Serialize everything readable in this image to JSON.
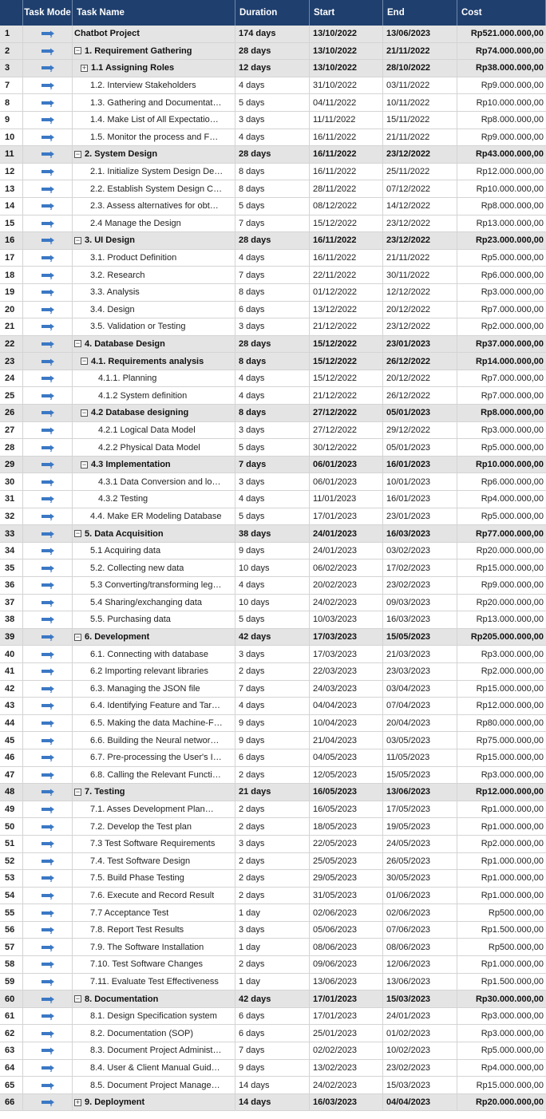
{
  "header": {
    "id": "",
    "task_mode": "Task Mode",
    "task_name": "Task Name",
    "duration": "Duration",
    "start": "Start",
    "end": "End",
    "cost": "Cost"
  },
  "icons": {
    "task_mode": "auto-scheduled-task-icon",
    "expand": "expand-plus-icon",
    "collapse": "collapse-minus-icon"
  },
  "colors": {
    "header_bg": "#1f3f6e",
    "summary_bg": "#e4e4e4",
    "mode_icon": "#3b78c4"
  },
  "rows": [
    {
      "id": "1",
      "name": "Chatbot Project",
      "duration": "174 days",
      "start": "13/10/2022",
      "end": "13/06/2023",
      "cost": "Rp521.000.000,00",
      "level": 0,
      "summary": true
    },
    {
      "id": "2",
      "name": "1. Requirement Gathering",
      "duration": "28 days",
      "start": "13/10/2022",
      "end": "21/11/2022",
      "cost": "Rp74.000.000,00",
      "level": 0,
      "summary": true,
      "toggle": "minus"
    },
    {
      "id": "3",
      "name": "1.1 Assigning Roles",
      "duration": "12 days",
      "start": "13/10/2022",
      "end": "28/10/2022",
      "cost": "Rp38.000.000,00",
      "level": 1,
      "summary": true,
      "toggle": "plus"
    },
    {
      "id": "7",
      "name": "1.2. Interview Stakeholders",
      "duration": "4 days",
      "start": "31/10/2022",
      "end": "03/11/2022",
      "cost": "Rp9.000.000,00",
      "level": 2
    },
    {
      "id": "8",
      "name": "1.3. Gathering and Documentat…",
      "duration": "5 days",
      "start": "04/11/2022",
      "end": "10/11/2022",
      "cost": "Rp10.000.000,00",
      "level": 2
    },
    {
      "id": "9",
      "name": "1.4. Make List of All Expectatio…",
      "duration": "3 days",
      "start": "11/11/2022",
      "end": "15/11/2022",
      "cost": "Rp8.000.000,00",
      "level": 2
    },
    {
      "id": "10",
      "name": "1.5. Monitor the process and  F…",
      "duration": "4 days",
      "start": "16/11/2022",
      "end": "21/11/2022",
      "cost": "Rp9.000.000,00",
      "level": 2
    },
    {
      "id": "11",
      "name": "2. System Design",
      "duration": "28 days",
      "start": "16/11/2022",
      "end": "23/12/2022",
      "cost": "Rp43.000.000,00",
      "level": 0,
      "summary": true,
      "toggle": "minus"
    },
    {
      "id": "12",
      "name": "2.1. Initialize System Design De…",
      "duration": "8 days",
      "start": "16/11/2022",
      "end": "25/11/2022",
      "cost": "Rp12.000.000,00",
      "level": 2
    },
    {
      "id": "13",
      "name": "2.2. Establish System Design C…",
      "duration": "8 days",
      "start": "28/11/2022",
      "end": "07/12/2022",
      "cost": "Rp10.000.000,00",
      "level": 2
    },
    {
      "id": "14",
      "name": "2.3. Assess alternatives for  obt…",
      "duration": "5 days",
      "start": "08/12/2022",
      "end": "14/12/2022",
      "cost": "Rp8.000.000,00",
      "level": 2
    },
    {
      "id": "15",
      "name": "2.4 Manage the Design",
      "duration": "7 days",
      "start": "15/12/2022",
      "end": "23/12/2022",
      "cost": "Rp13.000.000,00",
      "level": 2
    },
    {
      "id": "16",
      "name": "3. UI Design",
      "duration": "28 days",
      "start": "16/11/2022",
      "end": "23/12/2022",
      "cost": "Rp23.000.000,00",
      "level": 0,
      "summary": true,
      "toggle": "minus"
    },
    {
      "id": "17",
      "name": "3.1. Product Definition",
      "duration": "4 days",
      "start": "16/11/2022",
      "end": "21/11/2022",
      "cost": "Rp5.000.000,00",
      "level": 2
    },
    {
      "id": "18",
      "name": "3.2. Research",
      "duration": "7 days",
      "start": "22/11/2022",
      "end": "30/11/2022",
      "cost": "Rp6.000.000,00",
      "level": 2
    },
    {
      "id": "19",
      "name": "3.3. Analysis",
      "duration": "8 days",
      "start": "01/12/2022",
      "end": "12/12/2022",
      "cost": "Rp3.000.000,00",
      "level": 2
    },
    {
      "id": "20",
      "name": "3.4. Design",
      "duration": "6 days",
      "start": "13/12/2022",
      "end": "20/12/2022",
      "cost": "Rp7.000.000,00",
      "level": 2
    },
    {
      "id": "21",
      "name": "3.5. Validation or Testing",
      "duration": "3 days",
      "start": "21/12/2022",
      "end": "23/12/2022",
      "cost": "Rp2.000.000,00",
      "level": 2
    },
    {
      "id": "22",
      "name": "4. Database Design",
      "duration": "28 days",
      "start": "15/12/2022",
      "end": "23/01/2023",
      "cost": "Rp37.000.000,00",
      "level": 0,
      "summary": true,
      "toggle": "minus"
    },
    {
      "id": "23",
      "name": "4.1. Requirements analysis",
      "duration": "8 days",
      "start": "15/12/2022",
      "end": "26/12/2022",
      "cost": "Rp14.000.000,00",
      "level": 1,
      "summary": true,
      "toggle": "minus"
    },
    {
      "id": "24",
      "name": "4.1.1. Planning",
      "duration": "4 days",
      "start": "15/12/2022",
      "end": "20/12/2022",
      "cost": "Rp7.000.000,00",
      "level": 3
    },
    {
      "id": "25",
      "name": "4.1.2 System definition",
      "duration": "4 days",
      "start": "21/12/2022",
      "end": "26/12/2022",
      "cost": "Rp7.000.000,00",
      "level": 3
    },
    {
      "id": "26",
      "name": "4.2 Database designing",
      "duration": "8 days",
      "start": "27/12/2022",
      "end": "05/01/2023",
      "cost": "Rp8.000.000,00",
      "level": 1,
      "summary": true,
      "toggle": "minus"
    },
    {
      "id": "27",
      "name": "4.2.1 Logical Data Model",
      "duration": "3 days",
      "start": "27/12/2022",
      "end": "29/12/2022",
      "cost": "Rp3.000.000,00",
      "level": 3
    },
    {
      "id": "28",
      "name": "4.2.2 Physical Data Model",
      "duration": "5 days",
      "start": "30/12/2022",
      "end": "05/01/2023",
      "cost": "Rp5.000.000,00",
      "level": 3
    },
    {
      "id": "29",
      "name": "4.3 Implementation",
      "duration": "7 days",
      "start": "06/01/2023",
      "end": "16/01/2023",
      "cost": "Rp10.000.000,00",
      "level": 1,
      "summary": true,
      "toggle": "minus"
    },
    {
      "id": "30",
      "name": "4.3.1 Data Conversion and lo…",
      "duration": "3 days",
      "start": "06/01/2023",
      "end": "10/01/2023",
      "cost": "Rp6.000.000,00",
      "level": 3
    },
    {
      "id": "31",
      "name": "4.3.2 Testing",
      "duration": "4 days",
      "start": "11/01/2023",
      "end": "16/01/2023",
      "cost": "Rp4.000.000,00",
      "level": 3
    },
    {
      "id": "32",
      "name": "4.4. Make ER Modeling Database",
      "duration": "5 days",
      "start": "17/01/2023",
      "end": "23/01/2023",
      "cost": "Rp5.000.000,00",
      "level": 2
    },
    {
      "id": "33",
      "name": "5. Data Acquisition",
      "duration": "38 days",
      "start": "24/01/2023",
      "end": "16/03/2023",
      "cost": "Rp77.000.000,00",
      "level": 0,
      "summary": true,
      "toggle": "minus"
    },
    {
      "id": "34",
      "name": "5.1 Acquiring data",
      "duration": "9 days",
      "start": "24/01/2023",
      "end": "03/02/2023",
      "cost": "Rp20.000.000,00",
      "level": 2
    },
    {
      "id": "35",
      "name": "5.2. Collecting new data",
      "duration": "10 days",
      "start": "06/02/2023",
      "end": "17/02/2023",
      "cost": "Rp15.000.000,00",
      "level": 2
    },
    {
      "id": "36",
      "name": "5.3 Converting/transforming leg…",
      "duration": "4 days",
      "start": "20/02/2023",
      "end": "23/02/2023",
      "cost": "Rp9.000.000,00",
      "level": 2
    },
    {
      "id": "37",
      "name": "5.4 Sharing/exchanging data",
      "duration": "10 days",
      "start": "24/02/2023",
      "end": "09/03/2023",
      "cost": "Rp20.000.000,00",
      "level": 2
    },
    {
      "id": "38",
      "name": "5.5. Purchasing data",
      "duration": "5 days",
      "start": "10/03/2023",
      "end": "16/03/2023",
      "cost": "Rp13.000.000,00",
      "level": 2
    },
    {
      "id": "39",
      "name": "6. Development",
      "duration": "42 days",
      "start": "17/03/2023",
      "end": "15/05/2023",
      "cost": "Rp205.000.000,00",
      "level": 0,
      "summary": true,
      "toggle": "minus"
    },
    {
      "id": "40",
      "name": "6.1. Connecting with database",
      "duration": "3 days",
      "start": "17/03/2023",
      "end": "21/03/2023",
      "cost": "Rp3.000.000,00",
      "level": 2
    },
    {
      "id": "41",
      "name": "6.2 Importing relevant libraries",
      "duration": "2 days",
      "start": "22/03/2023",
      "end": "23/03/2023",
      "cost": "Rp2.000.000,00",
      "level": 2
    },
    {
      "id": "42",
      "name": "6.3. Managing the JSON file",
      "duration": "7 days",
      "start": "24/03/2023",
      "end": "03/04/2023",
      "cost": "Rp15.000.000,00",
      "level": 2
    },
    {
      "id": "43",
      "name": "6.4. Identifying Feature and Tar…",
      "duration": "4 days",
      "start": "04/04/2023",
      "end": "07/04/2023",
      "cost": "Rp12.000.000,00",
      "level": 2
    },
    {
      "id": "44",
      "name": "6.5. Making the data Machine-F…",
      "duration": "9 days",
      "start": "10/04/2023",
      "end": "20/04/2023",
      "cost": "Rp80.000.000,00",
      "level": 2
    },
    {
      "id": "45",
      "name": "6.6. Building the Neural networ…",
      "duration": "9 days",
      "start": "21/04/2023",
      "end": "03/05/2023",
      "cost": "Rp75.000.000,00",
      "level": 2
    },
    {
      "id": "46",
      "name": "6.7. Pre-processing the User's I…",
      "duration": "6 days",
      "start": "04/05/2023",
      "end": "11/05/2023",
      "cost": "Rp15.000.000,00",
      "level": 2
    },
    {
      "id": "47",
      "name": "6.8. Calling the Relevant Functi…",
      "duration": "2 days",
      "start": "12/05/2023",
      "end": "15/05/2023",
      "cost": "Rp3.000.000,00",
      "level": 2
    },
    {
      "id": "48",
      "name": "7. Testing",
      "duration": "21 days",
      "start": "16/05/2023",
      "end": "13/06/2023",
      "cost": "Rp12.000.000,00",
      "level": 0,
      "summary": true,
      "toggle": "minus"
    },
    {
      "id": "49",
      "name": "7.1. Asses Development Plan…",
      "duration": "2 days",
      "start": "16/05/2023",
      "end": "17/05/2023",
      "cost": "Rp1.000.000,00",
      "level": 2
    },
    {
      "id": "50",
      "name": "7.2. Develop the Test plan",
      "duration": "2 days",
      "start": "18/05/2023",
      "end": "19/05/2023",
      "cost": "Rp1.000.000,00",
      "level": 2
    },
    {
      "id": "51",
      "name": "7.3 Test Software Requirements",
      "duration": "3 days",
      "start": "22/05/2023",
      "end": "24/05/2023",
      "cost": "Rp2.000.000,00",
      "level": 2
    },
    {
      "id": "52",
      "name": "7.4. Test Software Design",
      "duration": "2 days",
      "start": "25/05/2023",
      "end": "26/05/2023",
      "cost": "Rp1.000.000,00",
      "level": 2
    },
    {
      "id": "53",
      "name": "7.5. Build Phase Testing",
      "duration": "2 days",
      "start": "29/05/2023",
      "end": "30/05/2023",
      "cost": "Rp1.000.000,00",
      "level": 2
    },
    {
      "id": "54",
      "name": "7.6. Execute and Record Result",
      "duration": "2 days",
      "start": "31/05/2023",
      "end": "01/06/2023",
      "cost": "Rp1.000.000,00",
      "level": 2
    },
    {
      "id": "55",
      "name": "7.7 Acceptance Test",
      "duration": "1 day",
      "start": "02/06/2023",
      "end": "02/06/2023",
      "cost": "Rp500.000,00",
      "level": 2
    },
    {
      "id": "56",
      "name": "7.8. Report Test Results",
      "duration": "3 days",
      "start": "05/06/2023",
      "end": "07/06/2023",
      "cost": "Rp1.500.000,00",
      "level": 2
    },
    {
      "id": "57",
      "name": "7.9. The Software Installation",
      "duration": "1 day",
      "start": "08/06/2023",
      "end": "08/06/2023",
      "cost": "Rp500.000,00",
      "level": 2
    },
    {
      "id": "58",
      "name": "7.10. Test Software Changes",
      "duration": "2 days",
      "start": "09/06/2023",
      "end": "12/06/2023",
      "cost": "Rp1.000.000,00",
      "level": 2
    },
    {
      "id": "59",
      "name": "7.11. Evaluate Test Effectiveness",
      "duration": "1 day",
      "start": "13/06/2023",
      "end": "13/06/2023",
      "cost": "Rp1.500.000,00",
      "level": 2
    },
    {
      "id": "60",
      "name": "8. Documentation",
      "duration": "42 days",
      "start": "17/01/2023",
      "end": "15/03/2023",
      "cost": "Rp30.000.000,00",
      "level": 0,
      "summary": true,
      "toggle": "minus"
    },
    {
      "id": "61",
      "name": "8.1. Design Specification system",
      "duration": "6 days",
      "start": "17/01/2023",
      "end": "24/01/2023",
      "cost": "Rp3.000.000,00",
      "level": 2
    },
    {
      "id": "62",
      "name": "8.2. Documentation (SOP)",
      "duration": "6 days",
      "start": "25/01/2023",
      "end": "01/02/2023",
      "cost": "Rp3.000.000,00",
      "level": 2
    },
    {
      "id": "63",
      "name": "8.3. Document Project Administ…",
      "duration": "7 days",
      "start": "02/02/2023",
      "end": "10/02/2023",
      "cost": "Rp5.000.000,00",
      "level": 2
    },
    {
      "id": "64",
      "name": "8.4. User & Client Manual Guid…",
      "duration": "9 days",
      "start": "13/02/2023",
      "end": "23/02/2023",
      "cost": "Rp4.000.000,00",
      "level": 2
    },
    {
      "id": "65",
      "name": "8.5. Document Project Manage…",
      "duration": "14 days",
      "start": "24/02/2023",
      "end": "15/03/2023",
      "cost": "Rp15.000.000,00",
      "level": 2
    },
    {
      "id": "66",
      "name": "9. Deployment",
      "duration": "14 days",
      "start": "16/03/2023",
      "end": "04/04/2023",
      "cost": "Rp20.000.000,00",
      "level": 0,
      "summary": true,
      "toggle": "plus"
    }
  ]
}
